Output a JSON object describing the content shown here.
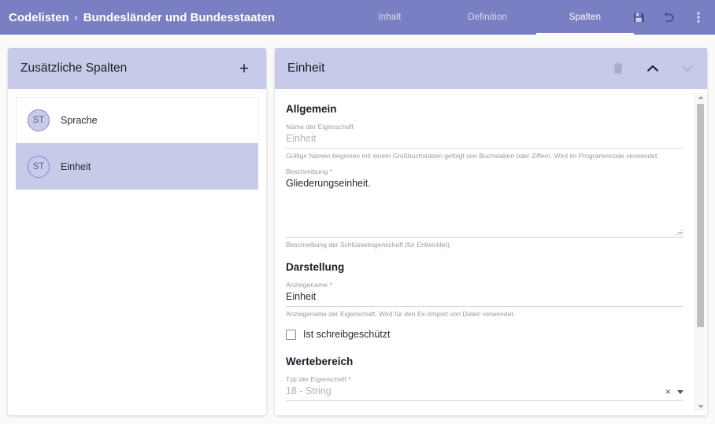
{
  "appbar": {
    "breadcrumb_root": "Codelisten",
    "breadcrumb_separator": "›",
    "breadcrumb_leaf": "Bundesländer und Bundesstaaten",
    "tabs": [
      {
        "label": "Inhalt",
        "active": false
      },
      {
        "label": "Definition",
        "active": false
      },
      {
        "label": "Spalten",
        "active": true
      }
    ],
    "actions": [
      {
        "name": "save-icon",
        "title": "Speichern"
      },
      {
        "name": "undo-icon",
        "title": "Rückgängig"
      },
      {
        "name": "more-vert-icon",
        "title": "Mehr"
      }
    ],
    "background_color": "#7a7fc3"
  },
  "sidebar": {
    "title": "Zusätzliche Spalten",
    "add_button_label": "+",
    "header_color": "#c7cae9",
    "items": [
      {
        "avatar": "ST",
        "label": "Sprache",
        "selected": false
      },
      {
        "avatar": "ST",
        "label": "Einheit",
        "selected": true
      }
    ]
  },
  "detail": {
    "title": "Einheit",
    "header_color": "#c7cae9",
    "actions": [
      {
        "name": "delete-icon",
        "title": "Löschen"
      },
      {
        "name": "chevron-up-icon",
        "title": "Nach oben"
      },
      {
        "name": "chevron-down-icon",
        "title": "Nach unten"
      }
    ],
    "sections": {
      "allgemein": {
        "heading": "Allgemein",
        "name_label": "Name der Eigenschaft",
        "name_value": "Einheit",
        "name_hint": "Gültige Namen beginnen mit einem Großbuchstaben gefolgt von Buchstaben oder Ziffern. Wird im Programmcode verwendet.",
        "description_label": "Beschreibung *",
        "description_value": "Gliederungseinheit.",
        "description_hint": "Beschreibung der Schlüsseleigenschaft (für Entwickler)."
      },
      "darstellung": {
        "heading": "Darstellung",
        "display_name_label": "Anzeigename *",
        "display_name_value": "Einheit",
        "display_name_hint": "Anzeigename der Eigenschaft. Wird für den Ex-/Import von Daten verwendet.",
        "checkbox_label": "Ist schreibgeschützt",
        "checkbox_checked": false
      },
      "wertebereich": {
        "heading": "Wertebereich",
        "type_label": "Typ der Eigenschaft *",
        "type_value": "18 - String",
        "clear_label": "×"
      }
    }
  }
}
